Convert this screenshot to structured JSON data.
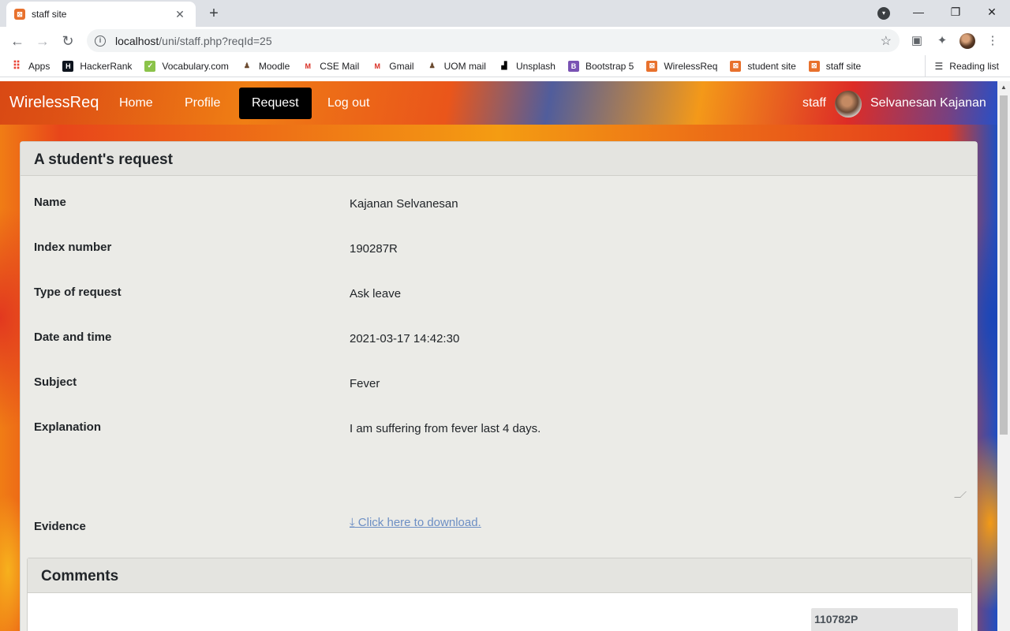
{
  "browser": {
    "tab_title": "staff site",
    "url_host": "localhost",
    "url_path": "/uni/staff.php?reqId=25",
    "bookmarks": [
      {
        "label": "Apps",
        "icon": "apps-grid-icon"
      },
      {
        "label": "HackerRank",
        "icon": "hackerrank-icon"
      },
      {
        "label": "Vocabulary.com",
        "icon": "vocabulary-icon"
      },
      {
        "label": "Moodle",
        "icon": "moodle-icon"
      },
      {
        "label": "CSE Mail",
        "icon": "gmail-icon"
      },
      {
        "label": "Gmail",
        "icon": "gmail-icon"
      },
      {
        "label": "UOM mail",
        "icon": "uom-icon"
      },
      {
        "label": "Unsplash",
        "icon": "unsplash-icon"
      },
      {
        "label": "Bootstrap 5",
        "icon": "bootstrap-icon"
      },
      {
        "label": "WirelessReq",
        "icon": "xampp-icon"
      },
      {
        "label": "student site",
        "icon": "xampp-icon"
      },
      {
        "label": "staff site",
        "icon": "xampp-icon"
      }
    ],
    "reading_list": "Reading list"
  },
  "nav": {
    "brand": "WirelessReq",
    "links": [
      "Home",
      "Profile",
      "Request",
      "Log out"
    ],
    "active": "Request",
    "role": "staff",
    "user_name": "Selvanesan Kajanan"
  },
  "request": {
    "header": "A student's request",
    "fields": [
      {
        "label": "Name",
        "value": "Kajanan Selvanesan"
      },
      {
        "label": "Index number",
        "value": "190287R"
      },
      {
        "label": "Type of request",
        "value": "Ask leave"
      },
      {
        "label": "Date and time",
        "value": "2021-03-17 14:42:30"
      },
      {
        "label": "Subject",
        "value": "Fever"
      },
      {
        "label": "Explanation",
        "value": "I am suffering from fever last 4 days."
      }
    ],
    "evidence_label": "Evidence",
    "evidence_link": " Click here to download."
  },
  "comments": {
    "header": "Comments",
    "author": "110782P"
  },
  "colors": {
    "active_nav": "#000000",
    "link": "#6d8fc4",
    "card_bg": "#ebebe7"
  }
}
